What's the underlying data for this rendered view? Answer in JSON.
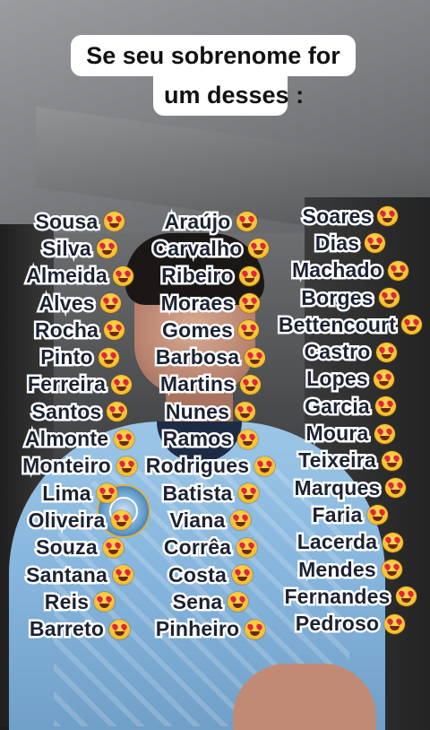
{
  "title": {
    "line1": "Se seu sobrenome for",
    "line2": "um desses :"
  },
  "accent_text_color": "#1a2233",
  "emoji_icon": "heart-eyes-emoji-icon",
  "columns": [
    [
      "Sousa",
      "Silva",
      "Almeida",
      "Alves",
      "Rocha",
      "Pinto",
      "Ferreira",
      "Santos",
      "Almonte",
      "Monteiro",
      "Lima",
      "Oliveira",
      "Souza",
      "Santana",
      "Reis",
      "Barreto"
    ],
    [
      "Araújo",
      "Carvalho",
      "Ribeiro",
      "Moraes",
      "Gomes",
      "Barbosa",
      "Martins",
      "Nunes",
      "Ramos",
      "Rodrigues",
      "Batista",
      "Viana",
      "Corrêa",
      "Costa",
      "Sena",
      "Pinheiro"
    ],
    [
      "Soares",
      "Dias",
      "Machado",
      "Borges",
      "Bettencourt",
      "Castro",
      "Lopes",
      "Garcia",
      "Moura",
      "Teixeira",
      "Marques",
      "Faria",
      "Lacerda",
      "Mendes",
      "Fernandes",
      "Pedroso"
    ]
  ]
}
